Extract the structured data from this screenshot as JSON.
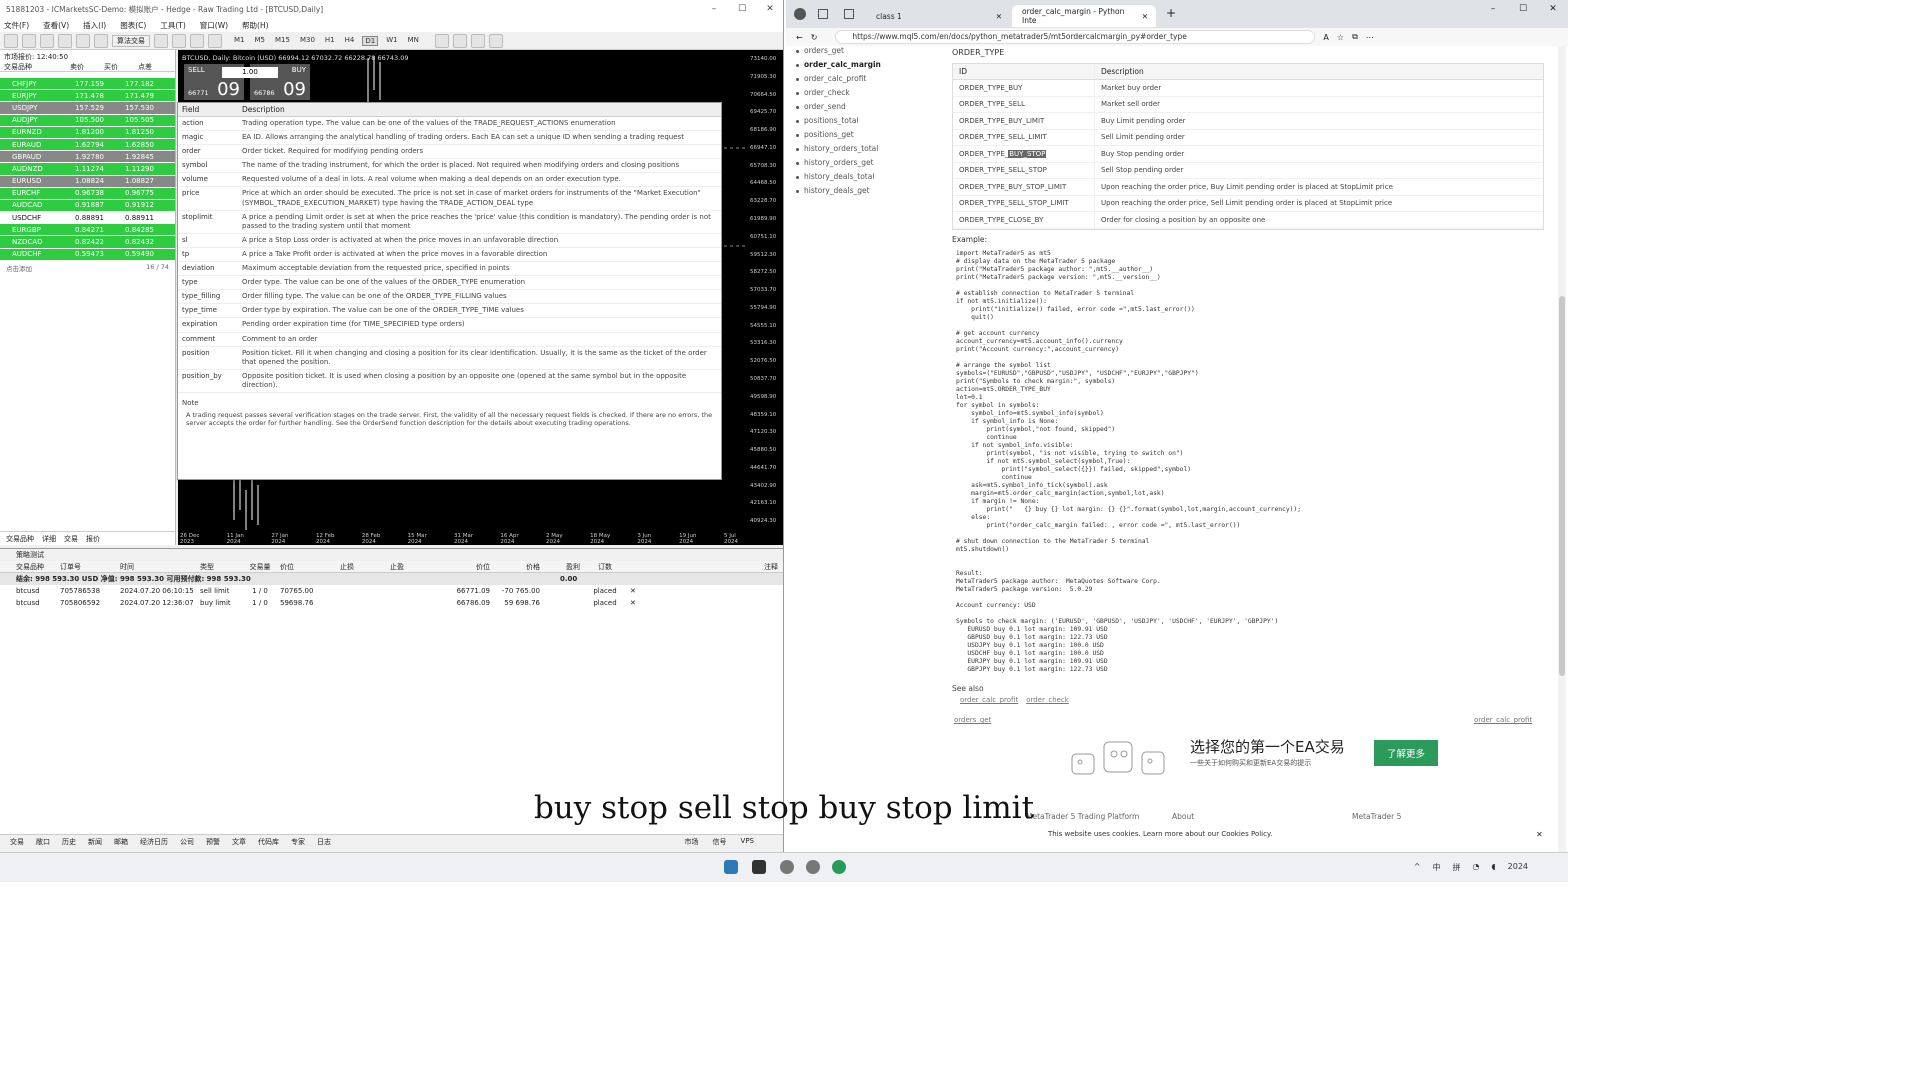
{
  "mt5": {
    "title": "51881203 - ICMarketsSC-Demo: 模拟账户 - Hedge - Raw Trading Ltd - [BTCUSD,Daily]",
    "menu": [
      "文件(F)",
      "查看(V)",
      "插入(I)",
      "图表(C)",
      "工具(T)",
      "窗口(W)",
      "帮助(H)"
    ],
    "algo_label": "算法交易",
    "timeframes": [
      "M1",
      "M5",
      "M15",
      "M30",
      "H1",
      "H4",
      "D1",
      "W1",
      "MN"
    ],
    "market_watch": {
      "title": "市场报价: 12:40:50",
      "col_symbol": "交易品种",
      "col_bid": "卖价",
      "col_ask": "买价",
      "col_change": "点差",
      "rows": [
        {
          "symbol": "CHFJPY",
          "bid": "177.159",
          "ask": "177.182",
          "color": "green"
        },
        {
          "symbol": "EURJPY",
          "bid": "171.478",
          "ask": "171.479",
          "color": "green"
        },
        {
          "symbol": "USDJPY",
          "bid": "157.529",
          "ask": "157.530",
          "color": "gray"
        },
        {
          "symbol": "AUDJPY",
          "bid": "105.500",
          "ask": "105.505",
          "color": "green"
        },
        {
          "symbol": "EURNZD",
          "bid": "1.81200",
          "ask": "1.81250",
          "color": "green"
        },
        {
          "symbol": "EURAUD",
          "bid": "1.62794",
          "ask": "1.62850",
          "color": "green"
        },
        {
          "symbol": "GBPAUD",
          "bid": "1.92780",
          "ask": "1.92845",
          "color": "gray"
        },
        {
          "symbol": "AUDNZD",
          "bid": "1.11274",
          "ask": "1.11290",
          "color": "green"
        },
        {
          "symbol": "EURUSD",
          "bid": "1.08824",
          "ask": "1.08827",
          "color": "gray"
        },
        {
          "symbol": "EURCHF",
          "bid": "0.96738",
          "ask": "0.96775",
          "color": "green"
        },
        {
          "symbol": "AUDCAD",
          "bid": "0.91887",
          "ask": "0.91912",
          "color": "green"
        },
        {
          "symbol": "USDCHF",
          "bid": "0.88891",
          "ask": "0.88911",
          "color": "white"
        },
        {
          "symbol": "EURGBP",
          "bid": "0.84271",
          "ask": "0.84285",
          "color": "green"
        },
        {
          "symbol": "NZDCAD",
          "bid": "0.82422",
          "ask": "0.82432",
          "color": "green"
        },
        {
          "symbol": "AUDCHF",
          "bid": "0.59473",
          "ask": "0.59490",
          "color": "green"
        }
      ],
      "add_label": "点击添加",
      "count": "16 / 74",
      "tabs": [
        "交易品种",
        "详细",
        "交易",
        "报价"
      ]
    },
    "chart": {
      "header": "BTCUSD, Daily: Bitcoin (USD)  66994.12 67032.72 66228.78 66743.09",
      "sell_label": "SELL",
      "buy_label": "BUY",
      "lot": "1.00",
      "sell_price_small": "66771",
      "sell_price_big": "09",
      "buy_price_small": "66786",
      "buy_price_big": "09",
      "price_labels": [
        "73140.00",
        "71905.30",
        "70664.50",
        "69425.70",
        "68186.90",
        "66947.10",
        "65708.30",
        "64468.50",
        "63228.70",
        "61989.90",
        "60751.10",
        "59512.30",
        "58272.50",
        "57033.70",
        "55794.90",
        "54555.10",
        "53316.30",
        "52076.50",
        "50837.70",
        "49598.90",
        "48359.10",
        "47120.30",
        "45880.50",
        "44641.70",
        "43402.90",
        "42163.10",
        "40924.30"
      ],
      "date_labels": [
        "26 Dec 2023",
        "11 Jan 2024",
        "27 Jan 2024",
        "12 Feb 2024",
        "28 Feb 2024",
        "15 Mar 2024",
        "31 Mar 2024",
        "16 Apr 2024",
        "2 May 2024",
        "18 May 2024",
        "3 Jun 2024",
        "19 Jun 2024",
        "5 Jul 2024"
      ]
    },
    "field_table": {
      "col_field": "Field",
      "col_desc": "Description",
      "rows": [
        {
          "field": "action",
          "desc": "Trading operation type. The value can be one of the values of the TRADE_REQUEST_ACTIONS enumeration"
        },
        {
          "field": "magic",
          "desc": "EA ID. Allows arranging the analytical handling of trading orders. Each EA can set a unique ID when sending a trading request"
        },
        {
          "field": "order",
          "desc": "Order ticket. Required for modifying pending orders"
        },
        {
          "field": "symbol",
          "desc": "The name of the trading instrument, for which the order is placed. Not required when modifying orders and closing positions"
        },
        {
          "field": "volume",
          "desc": "Requested volume of a deal in lots. A real volume when making a deal depends on an order execution type."
        },
        {
          "field": "price",
          "desc": "Price at which an order should be executed. The price is not set in case of market orders for instruments of the \"Market Execution\" (SYMBOL_TRADE_EXECUTION_MARKET) type having the TRADE_ACTION_DEAL type"
        },
        {
          "field": "stoplimit",
          "desc": "A price a pending Limit order is set at when the price reaches the 'price' value (this condition is mandatory). The pending order is not passed to the trading system until that moment"
        },
        {
          "field": "sl",
          "desc": "A price a Stop Loss order is activated at when the price moves in an unfavorable direction"
        },
        {
          "field": "tp",
          "desc": "A price a Take Profit order is activated at when the price moves in a favorable direction"
        },
        {
          "field": "deviation",
          "desc": "Maximum acceptable deviation from the requested price, specified in points"
        },
        {
          "field": "type",
          "desc": "Order type. The value can be one of the values of the ORDER_TYPE enumeration"
        },
        {
          "field": "type_filling",
          "desc": "Order filling type. The value can be one of the ORDER_TYPE_FILLING values"
        },
        {
          "field": "type_time",
          "desc": "Order type by expiration. The value can be one of the ORDER_TYPE_TIME values"
        },
        {
          "field": "expiration",
          "desc": "Pending order expiration time (for TIME_SPECIFIED type orders)"
        },
        {
          "field": "comment",
          "desc": "Comment to an order"
        },
        {
          "field": "position",
          "desc": "Position ticket. Fill it when changing and closing a position for its clear identification. Usually, it is the same as the ticket of the order that opened the position."
        },
        {
          "field": "position_by",
          "desc": "Opposite position ticket. It is used when closing a position by an opposite one (opened at the same symbol but in the opposite direction)."
        }
      ],
      "note_label": "Note",
      "note_text": "A trading request passes several verification stages on the trade server. First, the validity of all the necessary request fields is checked. If there are no errors, the server accepts the order for further handling. See the OrderSend function description for the details about executing trading operations."
    },
    "toolbox": {
      "header": "策略测试",
      "columns": [
        "交易品种",
        "订单号",
        "时间",
        "类型",
        "交易量",
        "价位",
        "止损",
        "止盈",
        "价位",
        "价格",
        "盈利",
        "订数"
      ],
      "note_col": "注释",
      "balance_line": "结余: 998 593.30 USD  净值: 998 593.30  可用预付款: 998 593.30",
      "balance_value": "0.00",
      "orders": [
        {
          "symbol": "btcusd",
          "ticket": "705786538",
          "time": "2024.07.20 06:10:15",
          "type": "sell limit",
          "volume": "1 / 0",
          "price": "70765.00",
          "cur": "66771.09",
          "diff": "-70 765.00",
          "state": "placed"
        },
        {
          "symbol": "btcusd",
          "ticket": "705806592",
          "time": "2024.07.20 12:36:07",
          "type": "buy limit",
          "volume": "1 / 0",
          "price": "59698.76",
          "cur": "66786.09",
          "diff": "59 698.76",
          "state": "placed"
        }
      ],
      "tabs": [
        "交易",
        "敞口",
        "历史",
        "新闻",
        "邮箱",
        "经济日历",
        "公司",
        "预警",
        "文章",
        "代码库",
        "专家",
        "日志"
      ],
      "market_label": "市场",
      "signal_label": "信号",
      "vps_label": "VPS"
    }
  },
  "browser": {
    "tab1": "class 1",
    "tab2": "order_calc_margin - Python Inte",
    "url": "https://www.mql5.com/en/docs/python_metatrader5/mt5ordercalcmargin_py#order_type",
    "nav": [
      "orders_get",
      "order_calc_margin",
      "order_calc_profit",
      "order_check",
      "order_send",
      "positions_total",
      "positions_get",
      "history_orders_total",
      "history_orders_get",
      "history_deals_total",
      "history_deals_get"
    ],
    "nav_active": "order_calc_margin",
    "ot_title": "ORDER_TYPE",
    "ot_col_id": "ID",
    "ot_col_desc": "Description",
    "order_types": [
      {
        "id": "ORDER_TYPE_BUY",
        "desc": "Market buy order"
      },
      {
        "id": "ORDER_TYPE_SELL",
        "desc": "Market sell order"
      },
      {
        "id": "ORDER_TYPE_BUY_LIMIT",
        "desc": "Buy Limit pending order"
      },
      {
        "id": "ORDER_TYPE_SELL_LIMIT",
        "desc": "Sell Limit pending order"
      },
      {
        "id": "ORDER_TYPE_BUY_STOP",
        "desc": "Buy Stop pending order"
      },
      {
        "id": "ORDER_TYPE_SELL_STOP",
        "desc": "Sell Stop pending order"
      },
      {
        "id": "ORDER_TYPE_BUY_STOP_LIMIT",
        "desc": "Upon reaching the order price, Buy Limit pending order is placed at StopLimit price"
      },
      {
        "id": "ORDER_TYPE_SELL_STOP_LIMIT",
        "desc": "Upon reaching the order price, Sell Limit pending order is placed at StopLimit price"
      },
      {
        "id": "ORDER_TYPE_CLOSE_BY",
        "desc": "Order for closing a position by an opposite one"
      }
    ],
    "highlight_prefix": "ORDER_TYPE_",
    "highlight_word": "BUY_STOP",
    "example_label": "Example:",
    "code": "import MetaTrader5 as mt5\n# display data on the MetaTrader 5 package\nprint(\"MetaTrader5 package author: \",mt5.__author__)\nprint(\"MetaTrader5 package version: \",mt5.__version__)\n\n# establish connection to MetaTrader 5 terminal\nif not mt5.initialize():\n    print(\"initialize() failed, error code =\",mt5.last_error())\n    quit()\n\n# get account currency\naccount_currency=mt5.account_info().currency\nprint(\"Account currency:\",account_currency)\n\n# arrange the symbol list\nsymbols=(\"EURUSD\",\"GBPUSD\",\"USDJPY\", \"USDCHF\",\"EURJPY\",\"GBPJPY\")\nprint(\"Symbols to check margin:\", symbols)\naction=mt5.ORDER_TYPE_BUY\nlot=0.1\nfor symbol in symbols:\n    symbol_info=mt5.symbol_info(symbol)\n    if symbol_info is None:\n        print(symbol,\"not found, skipped\")\n        continue\n    if not symbol_info.visible:\n        print(symbol, \"is not visible, trying to switch on\")\n        if not mt5.symbol_select(symbol,True):\n            print(\"symbol_select({}}) failed, skipped\",symbol)\n            continue\n    ask=mt5.symbol_info_tick(symbol).ask\n    margin=mt5.order_calc_margin(action,symbol,lot,ask)\n    if margin != None:\n        print(\"   {} buy {} lot margin: {} {}\".format(symbol,lot,margin,account_currency));\n    else:\n        print(\"order_calc_margin failed: , error code =\", mt5.last_error())\n\n# shut down connection to the MetaTrader 5 terminal\nmt5.shutdown()",
    "result": "Result:\nMetaTrader5 package author:  MetaQuotes Software Corp.\nMetaTrader5 package version:  5.0.29\n\nAccount currency: USD\n\nSymbols to check margin: ('EURUSD', 'GBPUSD', 'USDJPY', 'USDCHF', 'EURJPY', 'GBPJPY')\n   EURUSD buy 0.1 lot margin: 109.91 USD\n   GBPUSD buy 0.1 lot margin: 122.73 USD\n   USDJPY buy 0.1 lot margin: 100.0 USD\n   USDCHF buy 0.1 lot margin: 100.0 USD\n   EURJPY buy 0.1 lot margin: 109.91 USD\n   GBPJPY buy 0.1 lot margin: 122.73 USD",
    "see_also_label": "See also",
    "see_also_links": [
      "order_calc_profit",
      "order_check"
    ],
    "prev_link": "orders_get",
    "next_link": "order_calc_profit",
    "promo_title": "选择您的第一个EA交易",
    "promo_sub": "一些关于如何购买和更新EA交易的提示",
    "promo_button": "了解更多",
    "footer_left": "MetaTrader 5 Trading Platform",
    "footer_mid": "About",
    "footer_right": "MetaTrader 5",
    "cookie_text": "This website uses cookies. Learn more about our Cookies Policy."
  },
  "subtitle": "buy stop sell stop buy stop limit",
  "taskbar": {
    "ime": "中",
    "ime2": "拼",
    "year": "2024"
  },
  "colors": {
    "green_row": "#2ecc40",
    "promo_button": "#2b9a5a"
  }
}
